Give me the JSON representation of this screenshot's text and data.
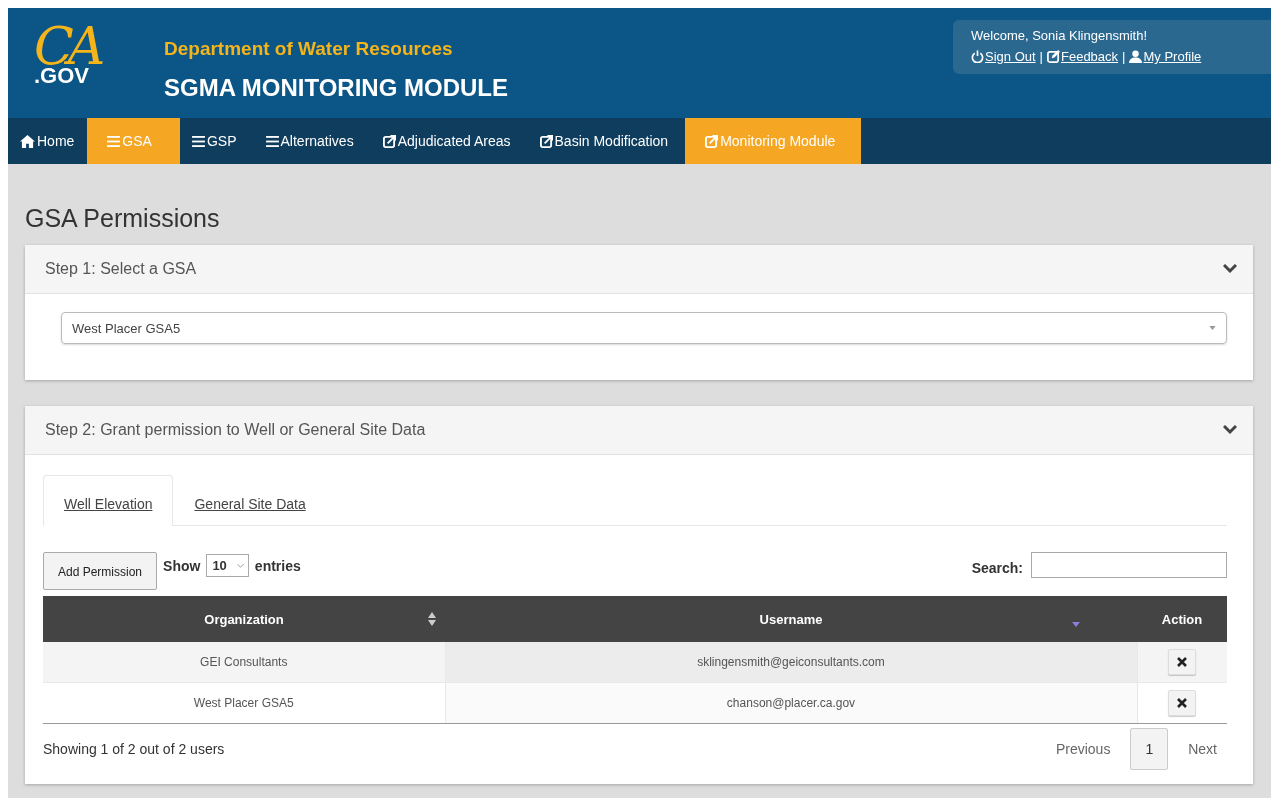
{
  "header": {
    "logo_top": "CA",
    "logo_bottom": ".GOV",
    "department": "Department of Water Resources",
    "module": "SGMA MONITORING MODULE",
    "welcome": "Welcome, Sonia Klingensmith!",
    "links": [
      {
        "kind": "power",
        "label": "Sign Out"
      },
      {
        "kind": "edit",
        "label": "Feedback"
      },
      {
        "kind": "user",
        "label": "My Profile"
      }
    ],
    "separator": "|"
  },
  "nav": [
    {
      "kind": "home",
      "label": "Home",
      "selected": false
    },
    {
      "kind": "menu",
      "label": "GSA",
      "selected": true
    },
    {
      "kind": "menu",
      "label": "GSP",
      "selected": false
    },
    {
      "kind": "menu",
      "label": "Alternatives",
      "selected": false
    },
    {
      "kind": "external",
      "label": "Adjudicated Areas",
      "selected": false
    },
    {
      "kind": "external",
      "label": "Basin Modification",
      "selected": false
    },
    {
      "kind": "external",
      "label": "Monitoring Module",
      "selected": true
    }
  ],
  "page_title": "GSA Permissions",
  "step1": {
    "title": "Step 1: Select a GSA",
    "expanded": true,
    "select_value": "West Placer GSA5"
  },
  "step2": {
    "title": "Step 2: Grant permission to Well or General Site Data",
    "expanded": true,
    "tabs": [
      {
        "label": "Well Elevation",
        "selected": true
      },
      {
        "label": "General Site Data",
        "selected": false
      }
    ],
    "add_button": "Add Permission",
    "show_label": "Show",
    "page_size": "10",
    "entries_label": "entries",
    "search_label": "Search:",
    "table": {
      "columns": [
        {
          "label": "Organization",
          "kind": "sortable"
        },
        {
          "label": "Username",
          "kind": "sorted"
        },
        {
          "label": "Action",
          "kind": "plain"
        }
      ],
      "rows": [
        {
          "organization": "GEI Consultants",
          "username": "sklingensmith@geiconsultants.com"
        },
        {
          "organization": "West Placer GSA5",
          "username": "chanson@placer.ca.gov"
        }
      ]
    },
    "info": "Showing 1 of 2 out of 2 users",
    "pagination": {
      "previous": "Previous",
      "pages": [
        {
          "label": "1",
          "selected": true
        }
      ],
      "next": "Next"
    }
  }
}
